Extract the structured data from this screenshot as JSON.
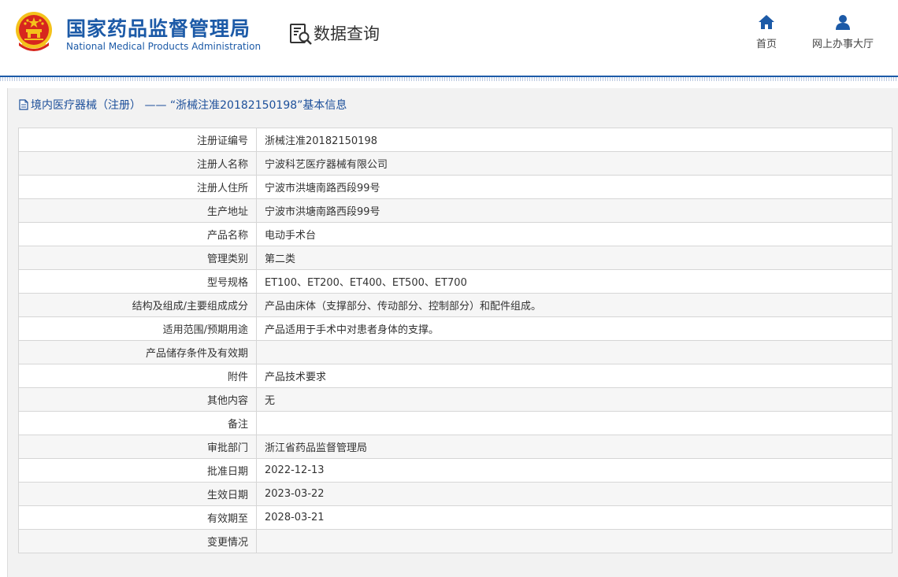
{
  "header": {
    "site_name_cn": "国家药品监督管理局",
    "site_name_en": "National Medical Products Administration",
    "section_title": "数据查询",
    "nav": [
      {
        "label": "首页",
        "icon": "home-icon"
      },
      {
        "label": "网上办事大厅",
        "icon": "user-icon"
      }
    ]
  },
  "panel": {
    "title": "境内医疗器械（注册） —— “浙械注准20182150198”基本信息",
    "title_icon": "document-icon"
  },
  "table": {
    "rows": [
      {
        "label": "注册证编号",
        "value": "浙械注准20182150198"
      },
      {
        "label": "注册人名称",
        "value": "宁波科艺医疗器械有限公司"
      },
      {
        "label": "注册人住所",
        "value": "宁波市洪塘南路西段99号"
      },
      {
        "label": "生产地址",
        "value": "宁波市洪塘南路西段99号"
      },
      {
        "label": "产品名称",
        "value": "电动手术台"
      },
      {
        "label": "管理类别",
        "value": "第二类"
      },
      {
        "label": "型号规格",
        "value": "ET100、ET200、ET400、ET500、ET700"
      },
      {
        "label": "结构及组成/主要组成成分",
        "value": "产品由床体（支撑部分、传动部分、控制部分）和配件组成。"
      },
      {
        "label": "适用范围/预期用途",
        "value": "产品适用于手术中对患者身体的支撑。"
      },
      {
        "label": "产品储存条件及有效期",
        "value": ""
      },
      {
        "label": "附件",
        "value": "产品技术要求"
      },
      {
        "label": "其他内容",
        "value": "无"
      },
      {
        "label": "备注",
        "value": ""
      },
      {
        "label": "审批部门",
        "value": "浙江省药品监督管理局"
      },
      {
        "label": "批准日期",
        "value": "2022-12-13"
      },
      {
        "label": "生效日期",
        "value": "2023-03-22"
      },
      {
        "label": "有效期至",
        "value": "2028-03-21"
      },
      {
        "label": "变更情况",
        "value": ""
      }
    ]
  },
  "colors": {
    "brand_blue": "#1c5aa7",
    "title_blue": "#1c4f9a",
    "emblem_red": "#d7261e",
    "emblem_gold": "#f4c21b",
    "nav_icon_blue": "#1c5aa7"
  }
}
